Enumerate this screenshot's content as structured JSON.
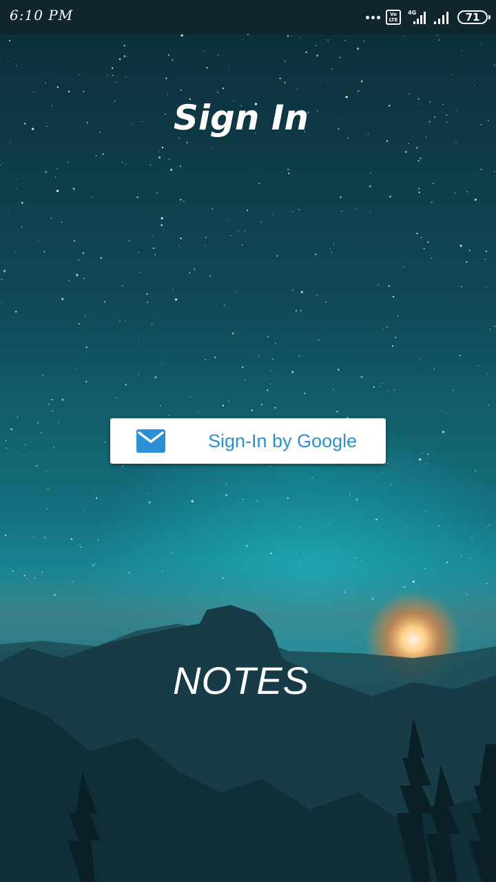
{
  "status_bar": {
    "time": "6:10 PM",
    "volte_label": "Vo LTE",
    "network_label": "4G",
    "battery_level": "71"
  },
  "screen": {
    "title": "Sign In",
    "app_name": "NOTES"
  },
  "signin": {
    "label": "Sign-In by Google",
    "icon": "mail-icon"
  },
  "colors": {
    "sky_top": "#0d3440",
    "sky_glow": "#19a7b5",
    "moon": "#ffd9a0",
    "button_text": "#2b8fd6",
    "mail_icon": "#2b8fd6"
  }
}
